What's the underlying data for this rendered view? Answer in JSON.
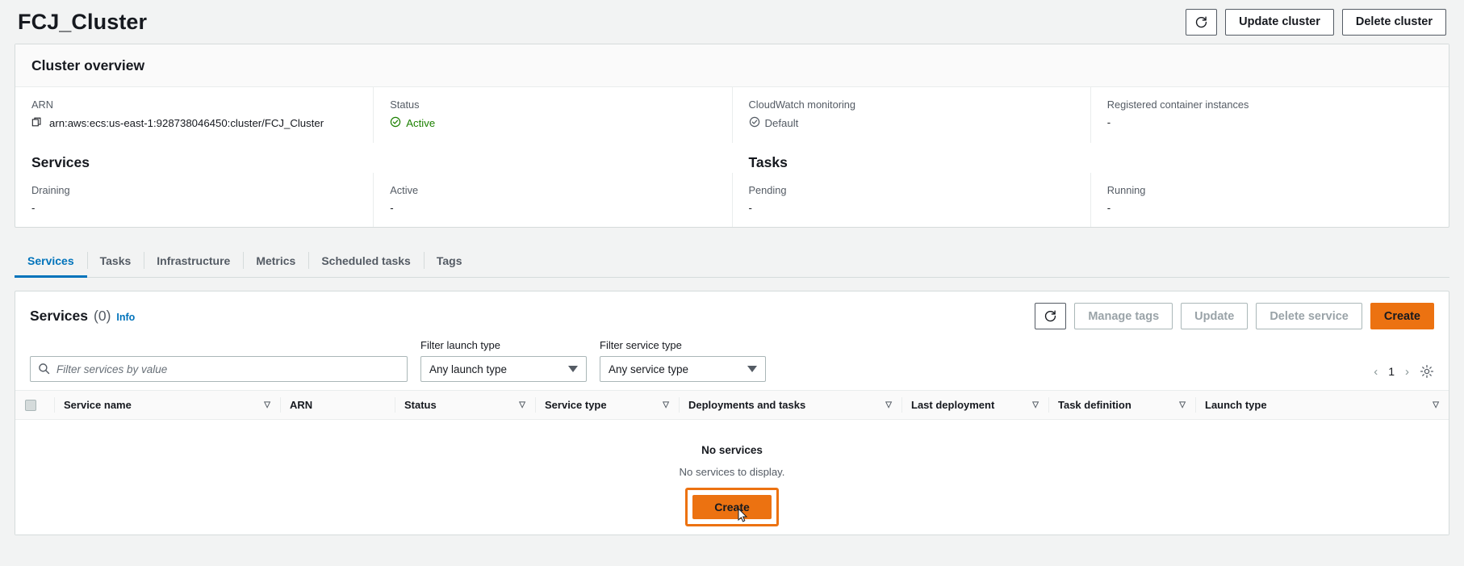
{
  "header": {
    "title": "FCJ_Cluster",
    "refresh_icon": "refresh-icon",
    "update_cluster_label": "Update cluster",
    "delete_cluster_label": "Delete cluster"
  },
  "overview": {
    "heading": "Cluster overview",
    "fields": [
      {
        "label": "ARN",
        "value": "arn:aws:ecs:us-east-1:928738046450:cluster/FCJ_Cluster",
        "icon": "copy-icon"
      },
      {
        "label": "Status",
        "value": "Active",
        "icon": "check-circle-icon",
        "color": "#1d8102"
      },
      {
        "label": "CloudWatch monitoring",
        "value": "Default",
        "icon": "check-circle-icon",
        "color": "#545b64"
      },
      {
        "label": "Registered container instances",
        "value": "-"
      }
    ],
    "groups": [
      {
        "title": "Services",
        "metrics": [
          {
            "label": "Draining",
            "value": "-"
          },
          {
            "label": "Active",
            "value": "-"
          }
        ]
      },
      {
        "title": "Tasks",
        "metrics": [
          {
            "label": "Pending",
            "value": "-"
          },
          {
            "label": "Running",
            "value": "-"
          }
        ]
      }
    ]
  },
  "tabs": [
    {
      "label": "Services",
      "active": true
    },
    {
      "label": "Tasks",
      "active": false
    },
    {
      "label": "Infrastructure",
      "active": false
    },
    {
      "label": "Metrics",
      "active": false
    },
    {
      "label": "Scheduled tasks",
      "active": false
    },
    {
      "label": "Tags",
      "active": false
    }
  ],
  "services_panel": {
    "title": "Services",
    "count": "(0)",
    "info_label": "Info",
    "refresh_icon": "refresh-icon",
    "manage_tags_label": "Manage tags",
    "update_label": "Update",
    "delete_service_label": "Delete service",
    "create_label": "Create",
    "search_placeholder": "Filter services by value",
    "launch_type_filter": {
      "label": "Filter launch type",
      "value": "Any launch type"
    },
    "service_type_filter": {
      "label": "Filter service type",
      "value": "Any service type"
    },
    "pagination": {
      "prev": "‹",
      "page": "1",
      "next": "›",
      "settings_icon": "gear-icon"
    },
    "columns": [
      "Service name",
      "ARN",
      "Status",
      "Service type",
      "Deployments and tasks",
      "Last deployment",
      "Task definition",
      "Launch type"
    ],
    "empty_state": {
      "title": "No services",
      "subtitle": "No services to display.",
      "create_label": "Create"
    }
  },
  "colors": {
    "accent_orange": "#ec7211",
    "link_blue": "#0073bb",
    "status_green": "#1d8102",
    "muted_gray": "#545b64"
  }
}
